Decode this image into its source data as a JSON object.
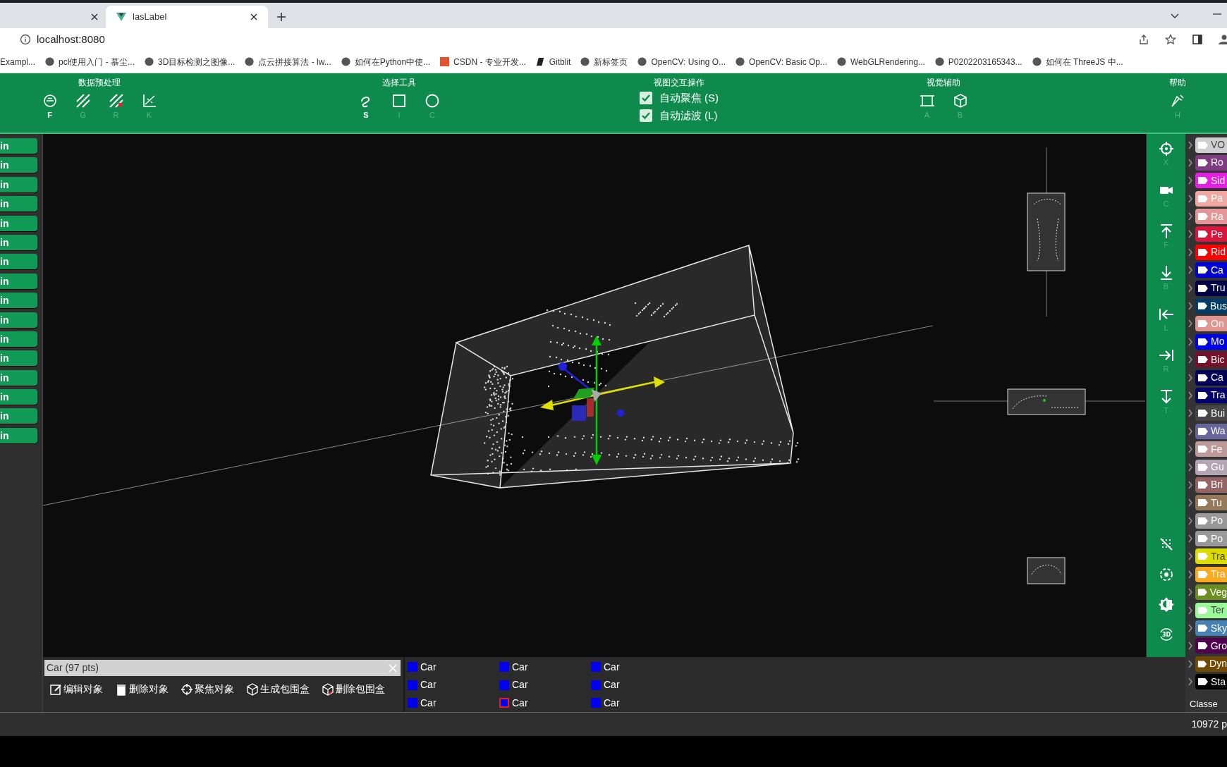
{
  "browser": {
    "tabs": [
      {
        "selected": false
      },
      {
        "title": "lasLabel",
        "selected": true
      }
    ],
    "address": "localhost:8080",
    "bookmarks": [
      "Exampl...",
      "pcl使用入门 - 慕尘...",
      "3D目标检测之图像...",
      "点云拼接算法 - lw...",
      "如何在Python中使...",
      "CSDN - 专业开发...",
      "Gitblit",
      "新标签页",
      "OpenCV: Using O...",
      "OpenCV: Basic Op...",
      "WebGLRendering...",
      "P0202203165343...",
      "如何在 ThreeJS 中..."
    ]
  },
  "toolbar": [
    {
      "title": "数据预处理",
      "items": [
        {
          "kind": "tool",
          "key": "F",
          "disabled": false
        },
        {
          "kind": "tool",
          "key": "G",
          "disabled": true
        },
        {
          "kind": "tool",
          "key": "R",
          "disabled": true
        },
        {
          "kind": "tool",
          "key": "K",
          "disabled": true
        }
      ]
    },
    {
      "title": "选择工具",
      "items": [
        {
          "kind": "tool",
          "key": "S",
          "disabled": false
        },
        {
          "kind": "tool",
          "key": "I",
          "disabled": true
        },
        {
          "kind": "tool",
          "key": "C",
          "disabled": true
        }
      ]
    },
    {
      "title": "视图交互操作",
      "items": [
        {
          "kind": "checkbox",
          "label": "自动聚焦 (S)",
          "checked": true
        },
        {
          "kind": "checkbox",
          "label": "自动滤波 (L)",
          "checked": true
        }
      ]
    },
    {
      "title": "视觉辅助",
      "items": [
        {
          "kind": "tool",
          "key": "A",
          "disabled": true
        },
        {
          "kind": "tool",
          "key": "B",
          "disabled": true
        }
      ]
    },
    {
      "title": "帮助",
      "items": [
        {
          "kind": "tool",
          "key": "H",
          "disabled": true
        }
      ]
    }
  ],
  "left_buttons": [
    {
      "label": "in"
    },
    {
      "label": "in"
    },
    {
      "label": "in"
    },
    {
      "label": "in"
    },
    {
      "label": "in"
    },
    {
      "label": "in"
    },
    {
      "label": "in"
    },
    {
      "label": "in"
    },
    {
      "label": "in"
    },
    {
      "label": "in"
    },
    {
      "label": "in"
    },
    {
      "label": "in"
    },
    {
      "label": "in"
    },
    {
      "label": "in"
    },
    {
      "label": "in"
    },
    {
      "label": "in"
    }
  ],
  "view_tools": [
    {
      "kind": "keyed",
      "key": "X"
    },
    {
      "kind": "keyed",
      "key": "C"
    },
    {
      "kind": "keyed",
      "key": "F"
    },
    {
      "kind": "keyed",
      "key": "B"
    },
    {
      "kind": "keyed",
      "key": "L"
    },
    {
      "kind": "keyed",
      "key": "R"
    },
    {
      "kind": "keyed",
      "key": "T"
    },
    {
      "kind": "plain"
    },
    {
      "kind": "plain"
    },
    {
      "kind": "plain"
    },
    {
      "kind": "plain",
      "label": "3D"
    }
  ],
  "selection": {
    "value": "Car (97 pts)"
  },
  "actions": [
    "编辑对象",
    "删除对象",
    "聚焦对象",
    "生成包围盒",
    "删除包围盒"
  ],
  "objects": [
    {
      "label": "Car",
      "color": "#0000ee",
      "selected": false
    },
    {
      "label": "Car",
      "color": "#0000ee",
      "selected": false
    },
    {
      "label": "Car",
      "color": "#0000ee",
      "selected": false
    },
    {
      "label": "Car",
      "color": "#0000ee",
      "selected": false
    },
    {
      "label": "Car",
      "color": "#0000ee",
      "selected": false
    },
    {
      "label": "Car",
      "color": "#0000ee",
      "selected": false
    },
    {
      "label": "Car",
      "color": "#0000ee",
      "selected": false
    },
    {
      "label": "Car",
      "color": "#0000ee",
      "selected": true
    },
    {
      "label": "Car",
      "color": "#0000ee",
      "selected": false
    }
  ],
  "classes": [
    {
      "name": "VO",
      "color": "#cfcfcf"
    },
    {
      "name": "Ro",
      "color": "#803c80"
    },
    {
      "name": "Sid",
      "color": "#e61ee6"
    },
    {
      "name": "Pa",
      "color": "#f2a8a0"
    },
    {
      "name": "Ra",
      "color": "#e69696"
    },
    {
      "name": "Pe",
      "color": "#dc143c"
    },
    {
      "name": "Rid",
      "color": "#ff0000"
    },
    {
      "name": "Ca",
      "color": "#0000d0"
    },
    {
      "name": "Tru",
      "color": "#000046"
    },
    {
      "name": "Bus",
      "color": "#003c64"
    },
    {
      "name": "On",
      "color": "#e09590"
    },
    {
      "name": "Mo",
      "color": "#0000e6"
    },
    {
      "name": "Bic",
      "color": "#77102a"
    },
    {
      "name": "Ca",
      "color": "#00005a"
    },
    {
      "name": "Tra",
      "color": "#00006e"
    },
    {
      "name": "Bui",
      "color": "#464646"
    },
    {
      "name": "Wa",
      "color": "#66669c"
    },
    {
      "name": "Fe",
      "color": "#be9999"
    },
    {
      "name": "Gu",
      "color": "#b4a5b4"
    },
    {
      "name": "Bri",
      "color": "#966464"
    },
    {
      "name": "Tu",
      "color": "#96785a"
    },
    {
      "name": "Po",
      "color": "#999999"
    },
    {
      "name": "Po",
      "color": "#999999"
    },
    {
      "name": "Tra",
      "color": "#dcdc00"
    },
    {
      "name": "Tra",
      "color": "#faaa1e"
    },
    {
      "name": "Veg",
      "color": "#6b8e23"
    },
    {
      "name": "Ter",
      "color": "#98fb98"
    },
    {
      "name": "Sky",
      "color": "#4682b4"
    },
    {
      "name": "Gro",
      "color": "#510051"
    },
    {
      "name": "Dyn",
      "color": "#6f4a00"
    },
    {
      "name": "Sta",
      "color": "#000000"
    }
  ],
  "classes_footer": "Classe",
  "status": "10972 p"
}
